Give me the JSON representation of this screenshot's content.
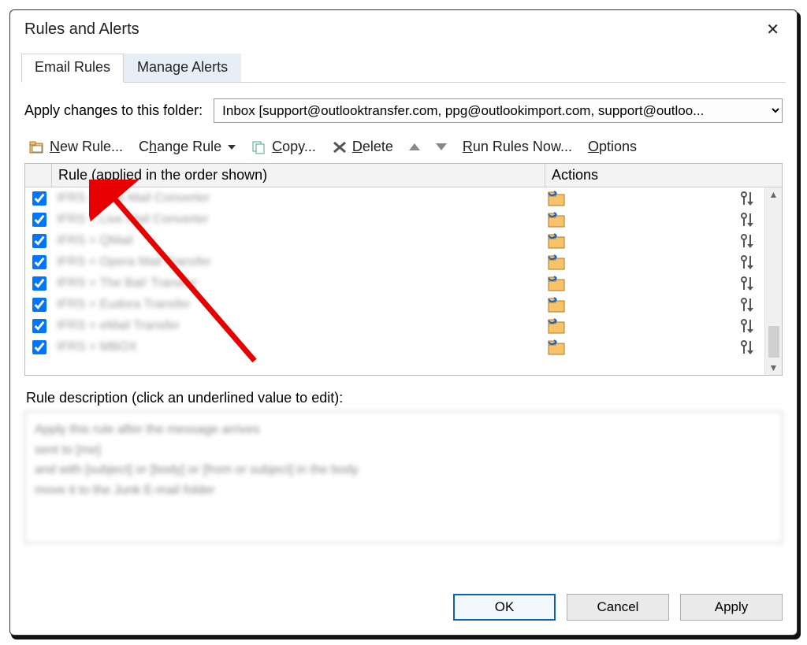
{
  "title": "Rules and Alerts",
  "tabs": {
    "email_rules": "Email Rules",
    "manage_alerts": "Manage Alerts"
  },
  "apply_label": "Apply changes to this folder:",
  "folder_value": "Inbox [support@outlooktransfer.com, ppg@outlookimport.com, support@outloo...",
  "toolbar": {
    "new_rule": "New Rule...",
    "change_rule": "Change Rule",
    "copy": "Copy...",
    "delete": "Delete",
    "run_now": "Run Rules Now...",
    "options": "Options"
  },
  "columns": {
    "rule": "Rule (applied in the order shown)",
    "actions": "Actions"
  },
  "rules": [
    {
      "checked": true,
      "name": "IFRS = Map Mail Converter"
    },
    {
      "checked": true,
      "name": "IFRS = Live Mail Converter"
    },
    {
      "checked": true,
      "name": "IFRS = QMail"
    },
    {
      "checked": true,
      "name": "IFRS = Opera Mail Transfer"
    },
    {
      "checked": true,
      "name": "IFRS = The Bat! Transfer"
    },
    {
      "checked": true,
      "name": "IFRS = Eudora Transfer"
    },
    {
      "checked": true,
      "name": "IFRS = eMail Transfer"
    },
    {
      "checked": true,
      "name": "IFRS = MBOX"
    }
  ],
  "desc_label": "Rule description (click an underlined value to edit):",
  "desc_lines": [
    "Apply this rule after the message arrives",
    "sent to [me]",
    "  and with [subject] or [body] or [from or subject]  in the body",
    "move it to the Junk E-mail folder"
  ],
  "buttons": {
    "ok": "OK",
    "cancel": "Cancel",
    "apply": "Apply"
  }
}
